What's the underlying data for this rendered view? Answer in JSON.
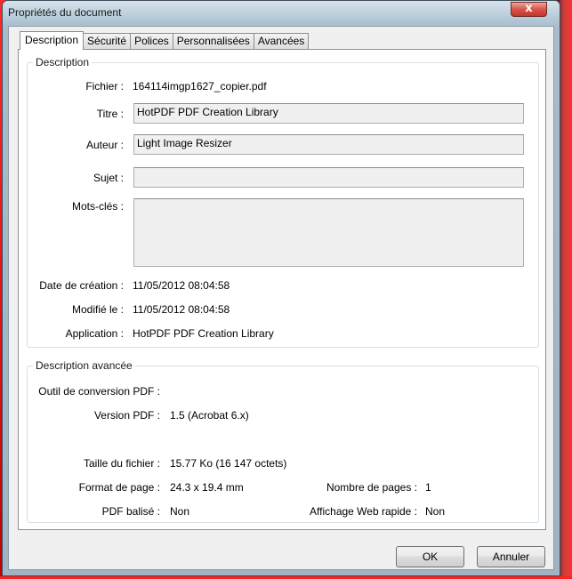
{
  "window": {
    "title": "Propriétés du document",
    "close_glyph": "x"
  },
  "tabs": [
    {
      "label": "Description",
      "active": true
    },
    {
      "label": "Sécurité",
      "active": false
    },
    {
      "label": "Polices",
      "active": false
    },
    {
      "label": "Personnalisées",
      "active": false
    },
    {
      "label": "Avancées",
      "active": false
    }
  ],
  "description": {
    "group_title": "Description",
    "fichier": {
      "label": "Fichier :",
      "value": "164114imgp1627_copier.pdf"
    },
    "titre": {
      "label": "Titre :",
      "value": "HotPDF PDF Creation Library"
    },
    "auteur": {
      "label": "Auteur :",
      "value": "Light Image Resizer"
    },
    "sujet": {
      "label": "Sujet :",
      "value": ""
    },
    "mots_cles": {
      "label": "Mots-clés :",
      "value": ""
    },
    "date_creation": {
      "label": "Date de création :",
      "value": "11/05/2012 08:04:58"
    },
    "modifie_le": {
      "label": "Modifié le :",
      "value": "11/05/2012 08:04:58"
    },
    "application": {
      "label": "Application :",
      "value": "HotPDF PDF Creation Library"
    }
  },
  "advanced": {
    "group_title": "Description avancée",
    "outil_conversion": {
      "label": "Outil de conversion PDF :",
      "value": ""
    },
    "version_pdf": {
      "label": "Version PDF :",
      "value": "1.5 (Acrobat 6.x)"
    },
    "taille_fichier": {
      "label": "Taille du fichier :",
      "value": "15.77 Ko (16 147 octets)"
    },
    "format_page": {
      "label": "Format de page :",
      "value": "24.3 x 19.4 mm"
    },
    "nombre_pages": {
      "label": "Nombre de pages :",
      "value": "1"
    },
    "pdf_balise": {
      "label": "PDF balisé :",
      "value": "Non"
    },
    "affichage_web": {
      "label": "Affichage Web rapide :",
      "value": "Non"
    }
  },
  "buttons": {
    "ok": "OK",
    "cancel": "Annuler"
  }
}
